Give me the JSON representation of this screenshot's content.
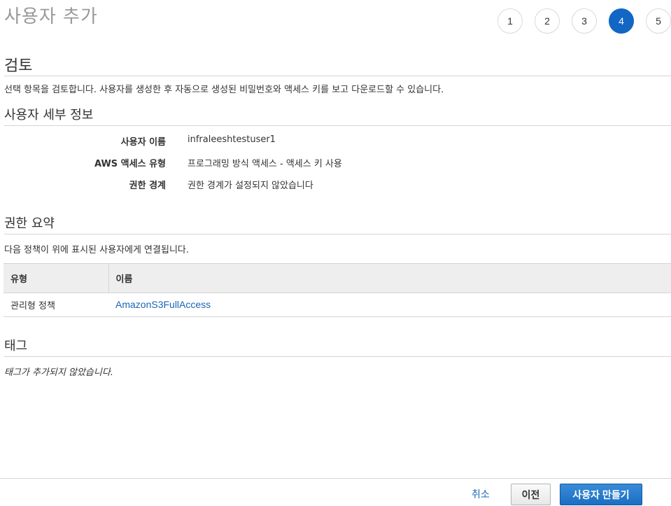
{
  "page_title": "사용자 추가",
  "steps": [
    "1",
    "2",
    "3",
    "4",
    "5"
  ],
  "active_step": "4",
  "review": {
    "heading": "검토",
    "description": "선택 항목을 검토합니다. 사용자를 생성한 후 자동으로 생성된 비밀번호와 액세스 키를 보고 다운로드할 수 있습니다."
  },
  "user_details": {
    "heading": "사용자 세부 정보",
    "rows": [
      {
        "label": "사용자 이름",
        "value": "infraleeshtestuser1"
      },
      {
        "label": "AWS 액세스 유형",
        "value": "프로그래밍 방식 액세스 - 액세스 키 사용"
      },
      {
        "label": "권한 경계",
        "value": "권한 경계가 설정되지 않았습니다"
      }
    ]
  },
  "permissions": {
    "heading": "권한 요약",
    "description": "다음 정책이 위에 표시된 사용자에게 연결됩니다.",
    "columns": [
      "유형",
      "이름"
    ],
    "rows": [
      {
        "type": "관리형 정책",
        "name": "AmazonS3FullAccess"
      }
    ]
  },
  "tags": {
    "heading": "태그",
    "empty_text": "태그가 추가되지 않았습니다."
  },
  "footer": {
    "cancel_label": "취소",
    "previous_label": "이전",
    "create_label": "사용자 만들기"
  },
  "colors": {
    "accent": "#1266c4",
    "link": "#1a66b5"
  }
}
